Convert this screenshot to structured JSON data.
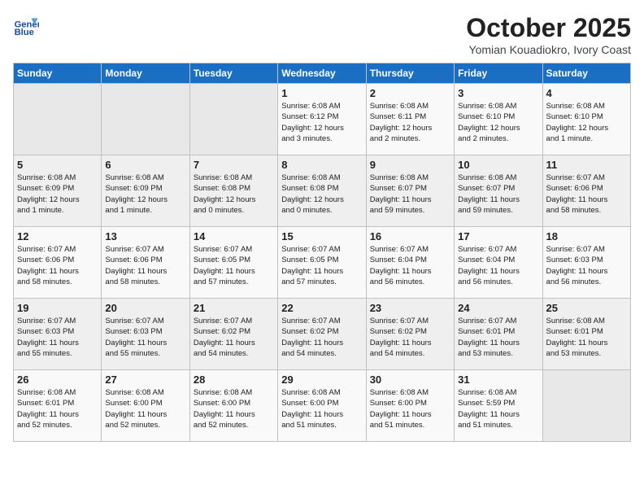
{
  "header": {
    "logo_line1": "General",
    "logo_line2": "Blue",
    "month_title": "October 2025",
    "location": "Yomian Kouadiokro, Ivory Coast"
  },
  "weekdays": [
    "Sunday",
    "Monday",
    "Tuesday",
    "Wednesday",
    "Thursday",
    "Friday",
    "Saturday"
  ],
  "weeks": [
    [
      {
        "day": "",
        "info": ""
      },
      {
        "day": "",
        "info": ""
      },
      {
        "day": "",
        "info": ""
      },
      {
        "day": "1",
        "info": "Sunrise: 6:08 AM\nSunset: 6:12 PM\nDaylight: 12 hours\nand 3 minutes."
      },
      {
        "day": "2",
        "info": "Sunrise: 6:08 AM\nSunset: 6:11 PM\nDaylight: 12 hours\nand 2 minutes."
      },
      {
        "day": "3",
        "info": "Sunrise: 6:08 AM\nSunset: 6:10 PM\nDaylight: 12 hours\nand 2 minutes."
      },
      {
        "day": "4",
        "info": "Sunrise: 6:08 AM\nSunset: 6:10 PM\nDaylight: 12 hours\nand 1 minute."
      }
    ],
    [
      {
        "day": "5",
        "info": "Sunrise: 6:08 AM\nSunset: 6:09 PM\nDaylight: 12 hours\nand 1 minute."
      },
      {
        "day": "6",
        "info": "Sunrise: 6:08 AM\nSunset: 6:09 PM\nDaylight: 12 hours\nand 1 minute."
      },
      {
        "day": "7",
        "info": "Sunrise: 6:08 AM\nSunset: 6:08 PM\nDaylight: 12 hours\nand 0 minutes."
      },
      {
        "day": "8",
        "info": "Sunrise: 6:08 AM\nSunset: 6:08 PM\nDaylight: 12 hours\nand 0 minutes."
      },
      {
        "day": "9",
        "info": "Sunrise: 6:08 AM\nSunset: 6:07 PM\nDaylight: 11 hours\nand 59 minutes."
      },
      {
        "day": "10",
        "info": "Sunrise: 6:08 AM\nSunset: 6:07 PM\nDaylight: 11 hours\nand 59 minutes."
      },
      {
        "day": "11",
        "info": "Sunrise: 6:07 AM\nSunset: 6:06 PM\nDaylight: 11 hours\nand 58 minutes."
      }
    ],
    [
      {
        "day": "12",
        "info": "Sunrise: 6:07 AM\nSunset: 6:06 PM\nDaylight: 11 hours\nand 58 minutes."
      },
      {
        "day": "13",
        "info": "Sunrise: 6:07 AM\nSunset: 6:06 PM\nDaylight: 11 hours\nand 58 minutes."
      },
      {
        "day": "14",
        "info": "Sunrise: 6:07 AM\nSunset: 6:05 PM\nDaylight: 11 hours\nand 57 minutes."
      },
      {
        "day": "15",
        "info": "Sunrise: 6:07 AM\nSunset: 6:05 PM\nDaylight: 11 hours\nand 57 minutes."
      },
      {
        "day": "16",
        "info": "Sunrise: 6:07 AM\nSunset: 6:04 PM\nDaylight: 11 hours\nand 56 minutes."
      },
      {
        "day": "17",
        "info": "Sunrise: 6:07 AM\nSunset: 6:04 PM\nDaylight: 11 hours\nand 56 minutes."
      },
      {
        "day": "18",
        "info": "Sunrise: 6:07 AM\nSunset: 6:03 PM\nDaylight: 11 hours\nand 56 minutes."
      }
    ],
    [
      {
        "day": "19",
        "info": "Sunrise: 6:07 AM\nSunset: 6:03 PM\nDaylight: 11 hours\nand 55 minutes."
      },
      {
        "day": "20",
        "info": "Sunrise: 6:07 AM\nSunset: 6:03 PM\nDaylight: 11 hours\nand 55 minutes."
      },
      {
        "day": "21",
        "info": "Sunrise: 6:07 AM\nSunset: 6:02 PM\nDaylight: 11 hours\nand 54 minutes."
      },
      {
        "day": "22",
        "info": "Sunrise: 6:07 AM\nSunset: 6:02 PM\nDaylight: 11 hours\nand 54 minutes."
      },
      {
        "day": "23",
        "info": "Sunrise: 6:07 AM\nSunset: 6:02 PM\nDaylight: 11 hours\nand 54 minutes."
      },
      {
        "day": "24",
        "info": "Sunrise: 6:07 AM\nSunset: 6:01 PM\nDaylight: 11 hours\nand 53 minutes."
      },
      {
        "day": "25",
        "info": "Sunrise: 6:08 AM\nSunset: 6:01 PM\nDaylight: 11 hours\nand 53 minutes."
      }
    ],
    [
      {
        "day": "26",
        "info": "Sunrise: 6:08 AM\nSunset: 6:01 PM\nDaylight: 11 hours\nand 52 minutes."
      },
      {
        "day": "27",
        "info": "Sunrise: 6:08 AM\nSunset: 6:00 PM\nDaylight: 11 hours\nand 52 minutes."
      },
      {
        "day": "28",
        "info": "Sunrise: 6:08 AM\nSunset: 6:00 PM\nDaylight: 11 hours\nand 52 minutes."
      },
      {
        "day": "29",
        "info": "Sunrise: 6:08 AM\nSunset: 6:00 PM\nDaylight: 11 hours\nand 51 minutes."
      },
      {
        "day": "30",
        "info": "Sunrise: 6:08 AM\nSunset: 6:00 PM\nDaylight: 11 hours\nand 51 minutes."
      },
      {
        "day": "31",
        "info": "Sunrise: 6:08 AM\nSunset: 5:59 PM\nDaylight: 11 hours\nand 51 minutes."
      },
      {
        "day": "",
        "info": ""
      }
    ]
  ]
}
